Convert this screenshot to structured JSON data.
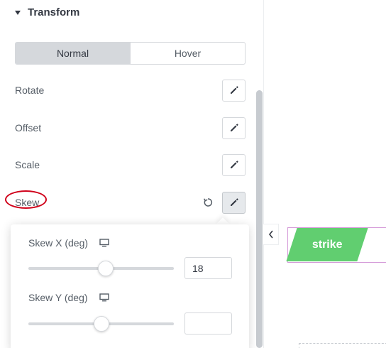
{
  "section": {
    "title": "Transform",
    "caret_icon": "caret-down-icon"
  },
  "tabs": [
    {
      "label": "Normal",
      "active": true
    },
    {
      "label": "Hover",
      "active": false
    }
  ],
  "controls": {
    "rotate": {
      "label": "Rotate"
    },
    "offset": {
      "label": "Offset"
    },
    "scale": {
      "label": "Scale"
    },
    "skew": {
      "label": "Skew"
    }
  },
  "skew_popover": {
    "skew_x": {
      "label": "Skew X (deg)",
      "value": "18",
      "slider_fraction": 0.53
    },
    "skew_y": {
      "label": "Skew Y (deg)",
      "value": "",
      "slider_fraction": 0.5
    }
  },
  "preview": {
    "button_text": "strike",
    "button_color": "#61ce70"
  },
  "colors": {
    "accent_annotation": "#d0021b",
    "tab_active_bg": "#d5d8dc"
  }
}
